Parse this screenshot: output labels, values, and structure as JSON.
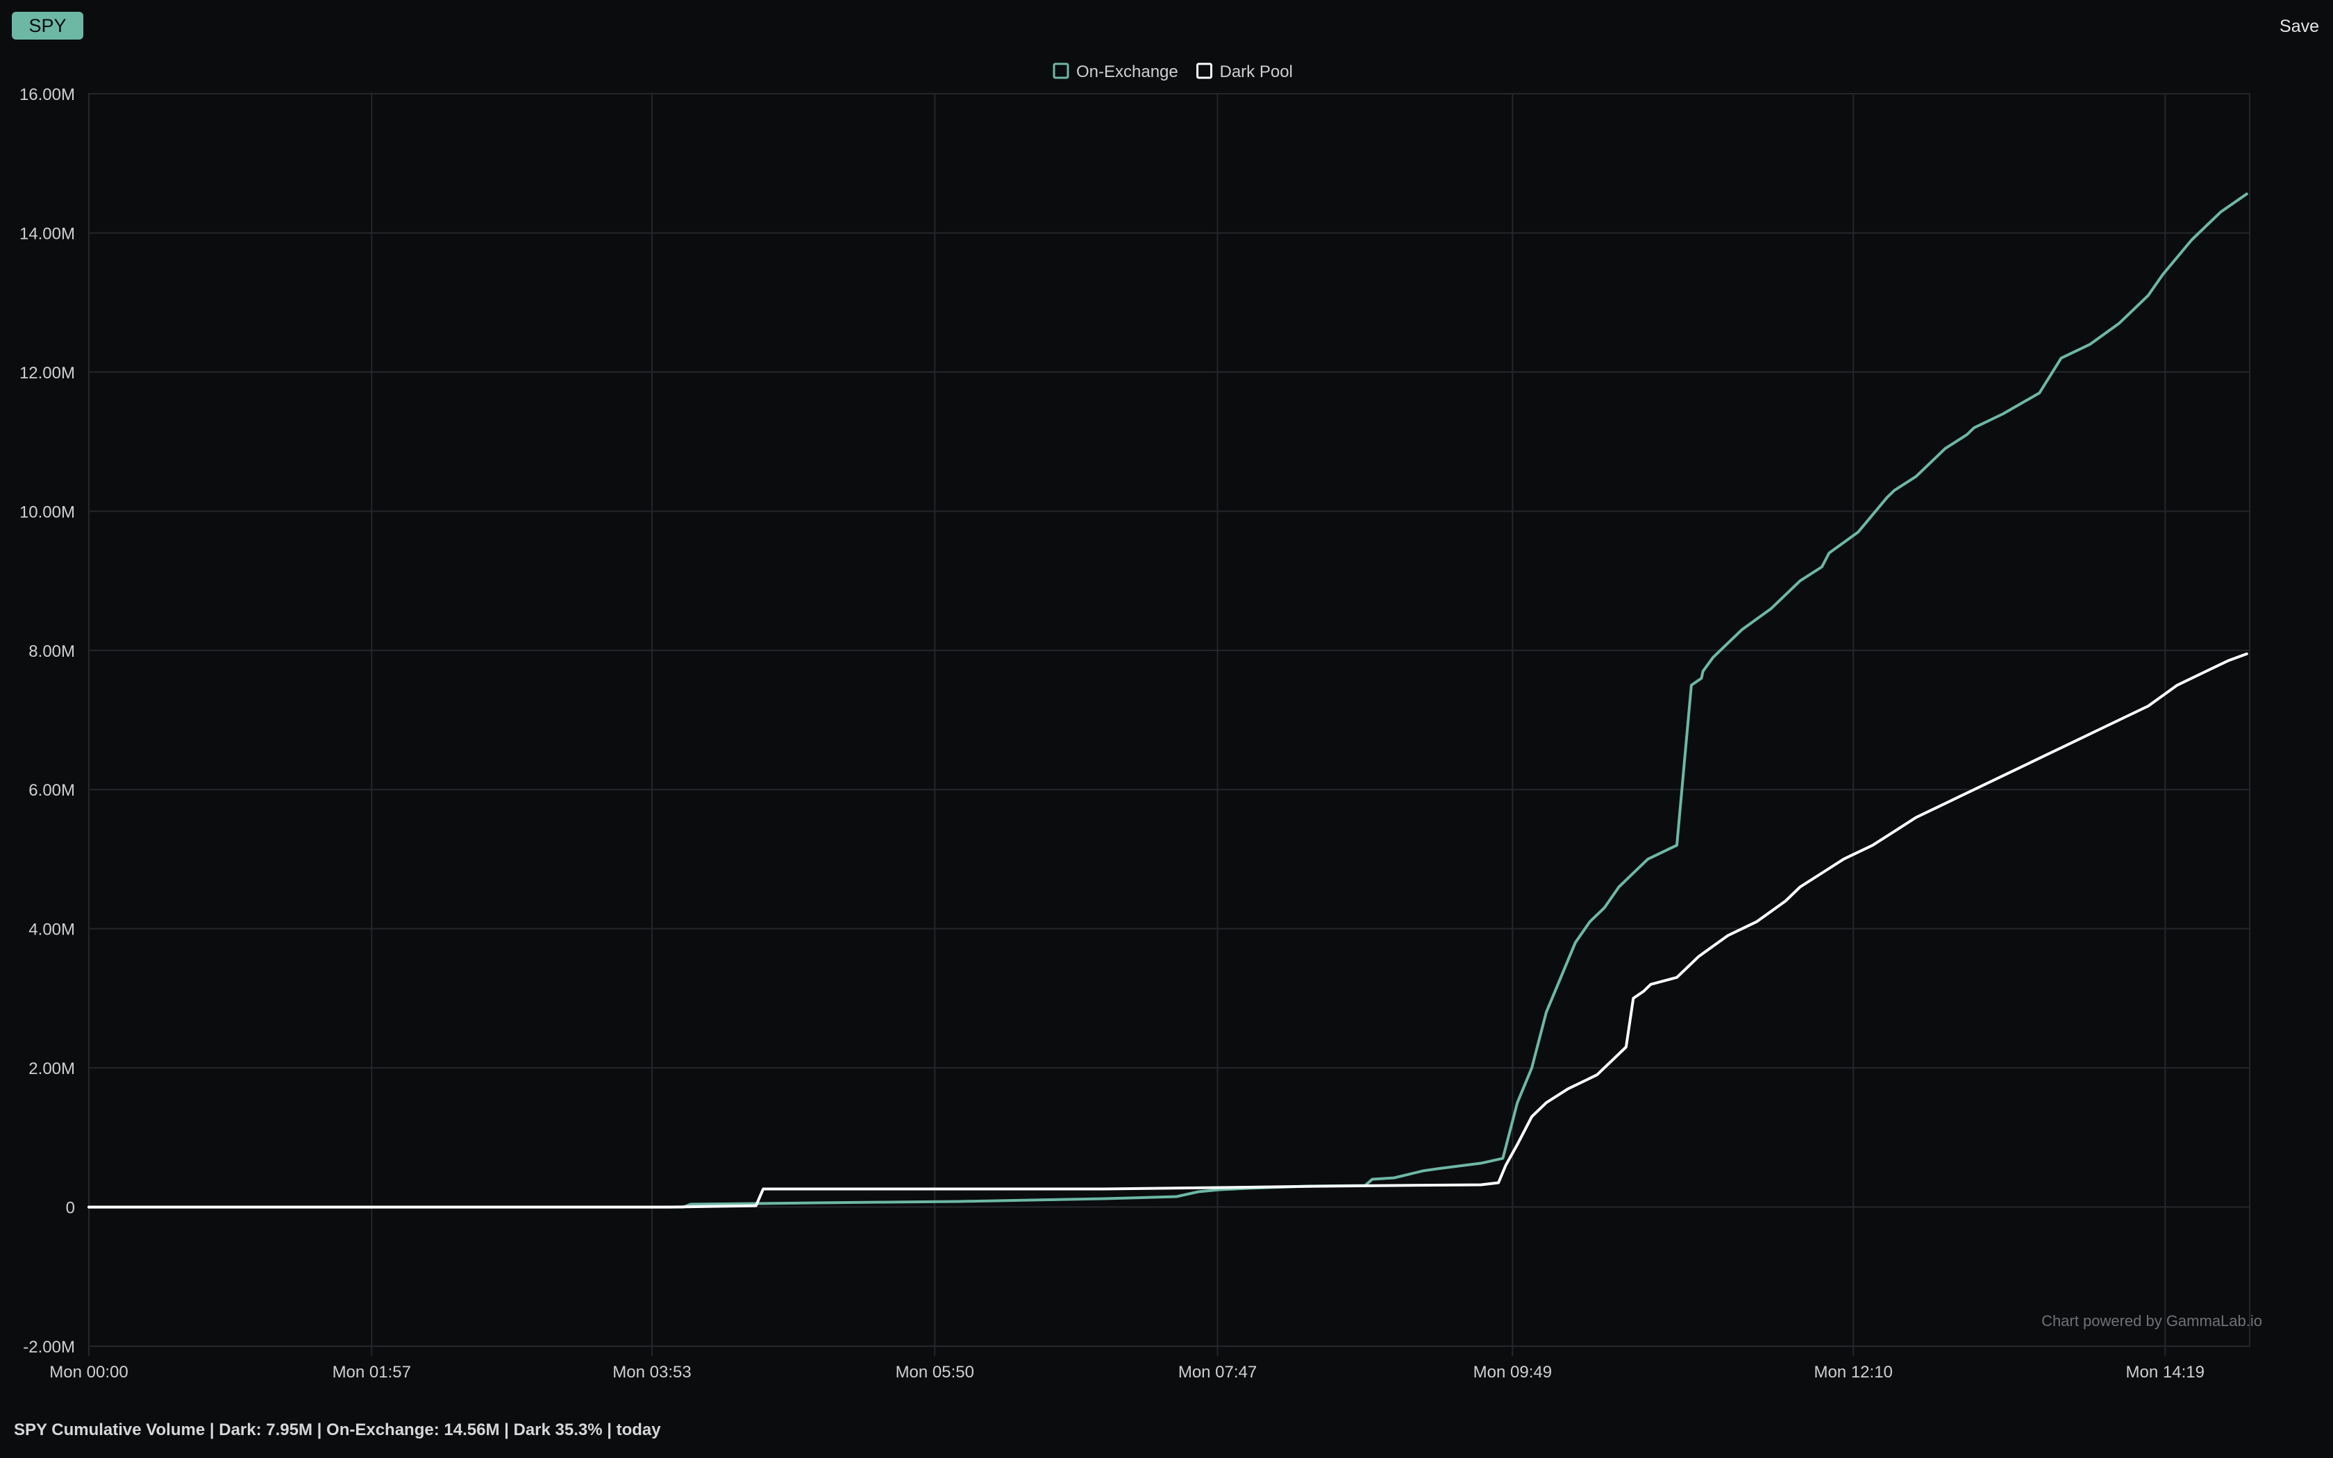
{
  "header": {
    "ticker": "SPY",
    "save_label": "Save"
  },
  "footer": {
    "summary": "SPY Cumulative Volume | Dark: 7.95M | On-Exchange: 14.56M | Dark 35.3% | today"
  },
  "watermark": "Chart powered by GammaLab.io",
  "colors": {
    "background": "#0b0c0e",
    "on_exchange": "#6db8a5",
    "dark_pool": "#ffffff",
    "grid": "#24262a",
    "axis_text": "#cfd0d2",
    "badge": "#6db8a5"
  },
  "chart_data": {
    "type": "line",
    "legend": {
      "placement": "top-center",
      "entries": [
        "On-Exchange",
        "Dark Pool"
      ]
    },
    "x_ticks": [
      "Mon 00:00",
      "Mon 01:57",
      "Mon 03:53",
      "Mon 05:50",
      "Mon 07:47",
      "Mon 09:49",
      "Mon 12:10",
      "Mon 14:19"
    ],
    "x_tick_hours": [
      0,
      1.95,
      3.883,
      5.833,
      7.783,
      9.817,
      12.167,
      14.317
    ],
    "xlim_hours": [
      0,
      14.9
    ],
    "y_ticks": [
      -2000000,
      0,
      2000000,
      4000000,
      6000000,
      8000000,
      10000000,
      12000000,
      14000000,
      16000000
    ],
    "y_tick_labels": [
      "-2.00M",
      "0",
      "2.00M",
      "4.00M",
      "6.00M",
      "8.00M",
      "10.00M",
      "12.00M",
      "14.00M",
      "16.00M"
    ],
    "ylim": [
      -2000000,
      16000000
    ],
    "grid": true,
    "series": [
      {
        "name": "On-Exchange",
        "x_hours": [
          0,
          1.0,
          2.0,
          3.0,
          4.1,
          4.15,
          4.6,
          5.0,
          5.5,
          6.0,
          6.5,
          7.0,
          7.5,
          7.65,
          7.8,
          8.0,
          8.4,
          8.8,
          8.85,
          9.0,
          9.2,
          9.3,
          9.6,
          9.75,
          9.85,
          9.95,
          10.05,
          10.15,
          10.25,
          10.35,
          10.45,
          10.55,
          10.75,
          10.95,
          11.05,
          11.12,
          11.13,
          11.2,
          11.4,
          11.6,
          11.8,
          11.95,
          12.0,
          12.2,
          12.4,
          12.45,
          12.6,
          12.8,
          12.95,
          13.0,
          13.2,
          13.45,
          13.6,
          13.8,
          14.0,
          14.1,
          14.2,
          14.3,
          14.5,
          14.7,
          14.88
        ],
        "values": [
          0,
          0,
          0,
          0,
          0,
          40000,
          50000,
          60000,
          70000,
          80000,
          100000,
          120000,
          150000,
          220000,
          250000,
          270000,
          300000,
          310000,
          400000,
          420000,
          520000,
          550000,
          630000,
          700000,
          1500000,
          2000000,
          2800000,
          3300000,
          3800000,
          4100000,
          4300000,
          4600000,
          5000000,
          5200000,
          7500000,
          7600000,
          7700000,
          7900000,
          8300000,
          8600000,
          9000000,
          9200000,
          9400000,
          9700000,
          10200000,
          10300000,
          10500000,
          10900000,
          11100000,
          11200000,
          11400000,
          11700000,
          12200000,
          12400000,
          12700000,
          12900000,
          13100000,
          13400000,
          13900000,
          14300000,
          14560000
        ]
      },
      {
        "name": "Dark Pool",
        "x_hours": [
          0,
          4.0,
          4.6,
          4.65,
          5.0,
          6.0,
          7.0,
          7.8,
          8.5,
          9.0,
          9.6,
          9.72,
          9.77,
          9.85,
          9.95,
          10.05,
          10.2,
          10.4,
          10.5,
          10.6,
          10.65,
          10.72,
          10.77,
          10.95,
          11.1,
          11.3,
          11.5,
          11.7,
          11.8,
          11.95,
          12.1,
          12.3,
          12.45,
          12.6,
          12.8,
          12.9,
          13.1,
          13.3,
          13.5,
          13.7,
          13.9,
          14.0,
          14.2,
          14.4,
          14.6,
          14.75,
          14.88
        ],
        "values": [
          0,
          0,
          20000,
          260000,
          260000,
          260000,
          260000,
          280000,
          300000,
          310000,
          320000,
          350000,
          600000,
          900000,
          1300000,
          1500000,
          1700000,
          1900000,
          2100000,
          2300000,
          3000000,
          3100000,
          3200000,
          3300000,
          3600000,
          3900000,
          4100000,
          4400000,
          4600000,
          4800000,
          5000000,
          5200000,
          5400000,
          5600000,
          5800000,
          5900000,
          6100000,
          6300000,
          6500000,
          6700000,
          6900000,
          7000000,
          7200000,
          7500000,
          7700000,
          7850000,
          7950000
        ]
      }
    ]
  }
}
